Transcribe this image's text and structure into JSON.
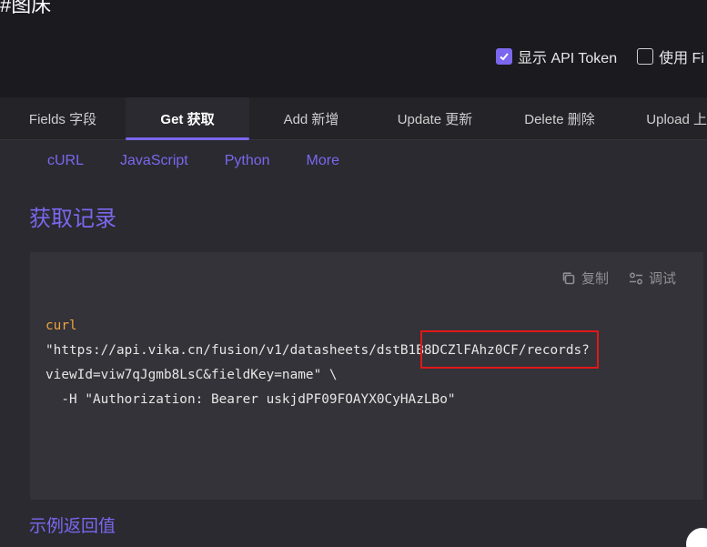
{
  "page": {
    "title": "#图床"
  },
  "options": [
    {
      "label": "显示 API Token",
      "checked": true
    },
    {
      "label": "使用 Fi",
      "checked": false
    }
  ],
  "tabs": [
    {
      "label": "Fields 字段",
      "active": false
    },
    {
      "label": "Get 获取",
      "active": true
    },
    {
      "label": "Add 新增",
      "active": false
    },
    {
      "label": "Update 更新",
      "active": false
    },
    {
      "label": "Delete 删除",
      "active": false
    },
    {
      "label": "Upload 上",
      "active": false
    }
  ],
  "subtabs": [
    "cURL",
    "JavaScript",
    "Python",
    "More"
  ],
  "section": {
    "title": "获取记录",
    "bottom_title": "示例返回值"
  },
  "code_tools": {
    "copy": "复制",
    "debug": "调试"
  },
  "code": {
    "line1": "curl",
    "line2a": "\"https://api.vika.cn/fusion/v1/datasheets/",
    "line2b": "dstB1B8DCZlFAhz0CF/",
    "line2c": "records?",
    "line3": "viewId=viw7qJgmb8LsC&fieldKey=name\" \\",
    "line4": "  -H \"Authorization: Bearer uskjdPF09FOAYX0CyHAzLBo\""
  },
  "colors": {
    "accent": "#7b67ee",
    "keyword": "#f0a33c",
    "highlight": "#e01818"
  }
}
